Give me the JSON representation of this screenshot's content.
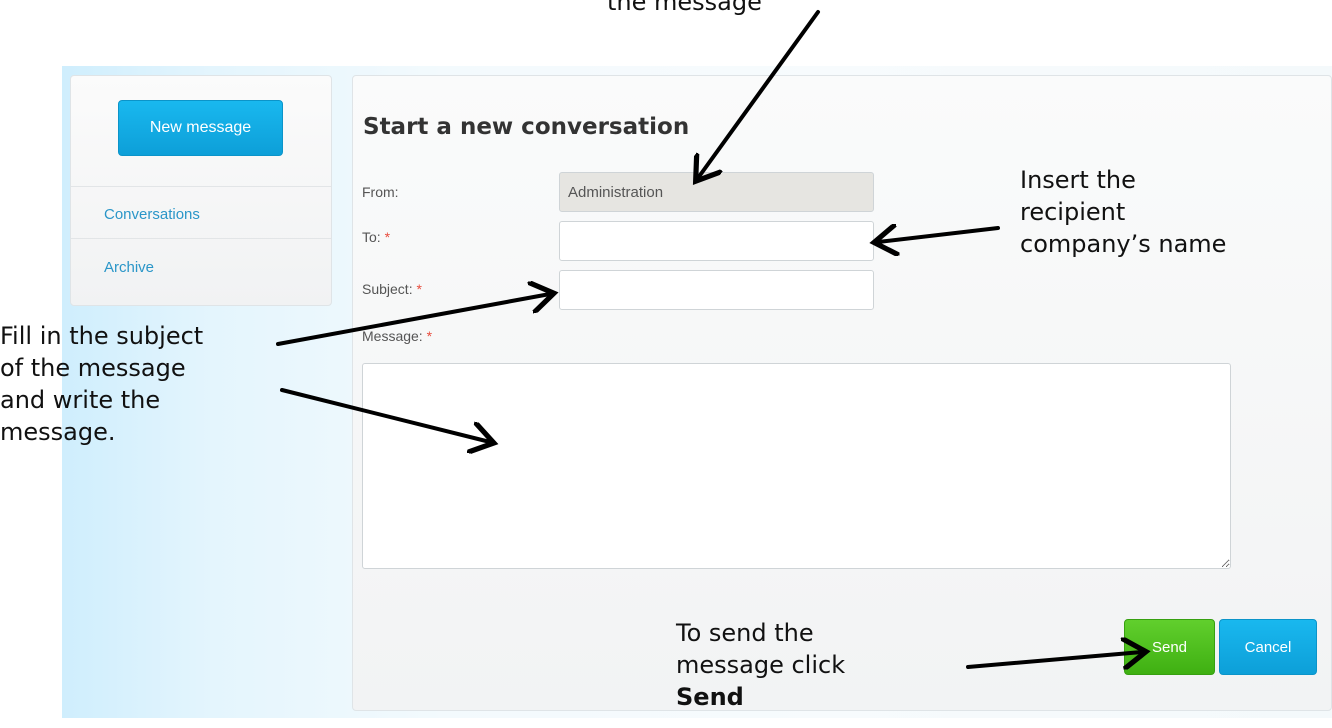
{
  "sidebar": {
    "new_message_label": "New message",
    "items": [
      {
        "label": "Conversations"
      },
      {
        "label": "Archive"
      }
    ]
  },
  "main": {
    "title": "Start a new conversation",
    "from": {
      "label": "From:",
      "value": "Administration"
    },
    "to": {
      "label": "To:",
      "required_mark": "*",
      "value": ""
    },
    "subject": {
      "label": "Subject:",
      "required_mark": "*",
      "value": ""
    },
    "message": {
      "label": "Message:",
      "required_mark": "*",
      "value": ""
    },
    "send_label": "Send",
    "cancel_label": "Cancel"
  },
  "annotations": {
    "top_note_partial": "the message",
    "recipient_note": [
      "Insert the",
      "recipient",
      "company’s name"
    ],
    "subject_note": [
      "Fill in the subject",
      "of the message",
      "and write the",
      "message."
    ],
    "send_note": [
      "To send the",
      "message click"
    ],
    "send_note_bold": "Send"
  },
  "colors": {
    "accent_blue": "#0d9fd8",
    "send_green": "#3fb012",
    "required_red": "#e84c3d",
    "link_blue": "#2a96c8"
  }
}
